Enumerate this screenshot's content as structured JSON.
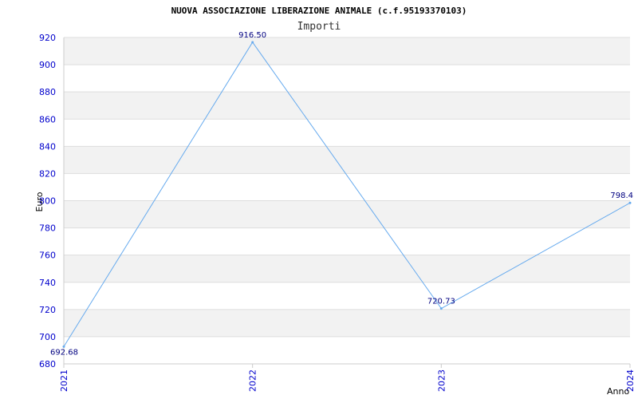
{
  "chart_data": {
    "type": "line",
    "title": "NUOVA ASSOCIAZIONE LIBERAZIONE ANIMALE (c.f.95193370103)",
    "subtitle": "Importi",
    "xlabel": "Anno",
    "ylabel": "Euro",
    "categories": [
      "2021",
      "2022",
      "2023",
      "2024"
    ],
    "values": [
      692.68,
      916.5,
      720.73,
      798.4
    ],
    "data_labels": [
      "692.68",
      "916.50",
      "720.73",
      "798.4"
    ],
    "ylim": [
      680,
      920
    ],
    "yticks": [
      "680",
      "700",
      "720",
      "740",
      "760",
      "780",
      "800",
      "820",
      "840",
      "860",
      "880",
      "900",
      "920"
    ],
    "grid": true,
    "line_color": "#66aaee",
    "band_color": "#f2f2f2"
  }
}
